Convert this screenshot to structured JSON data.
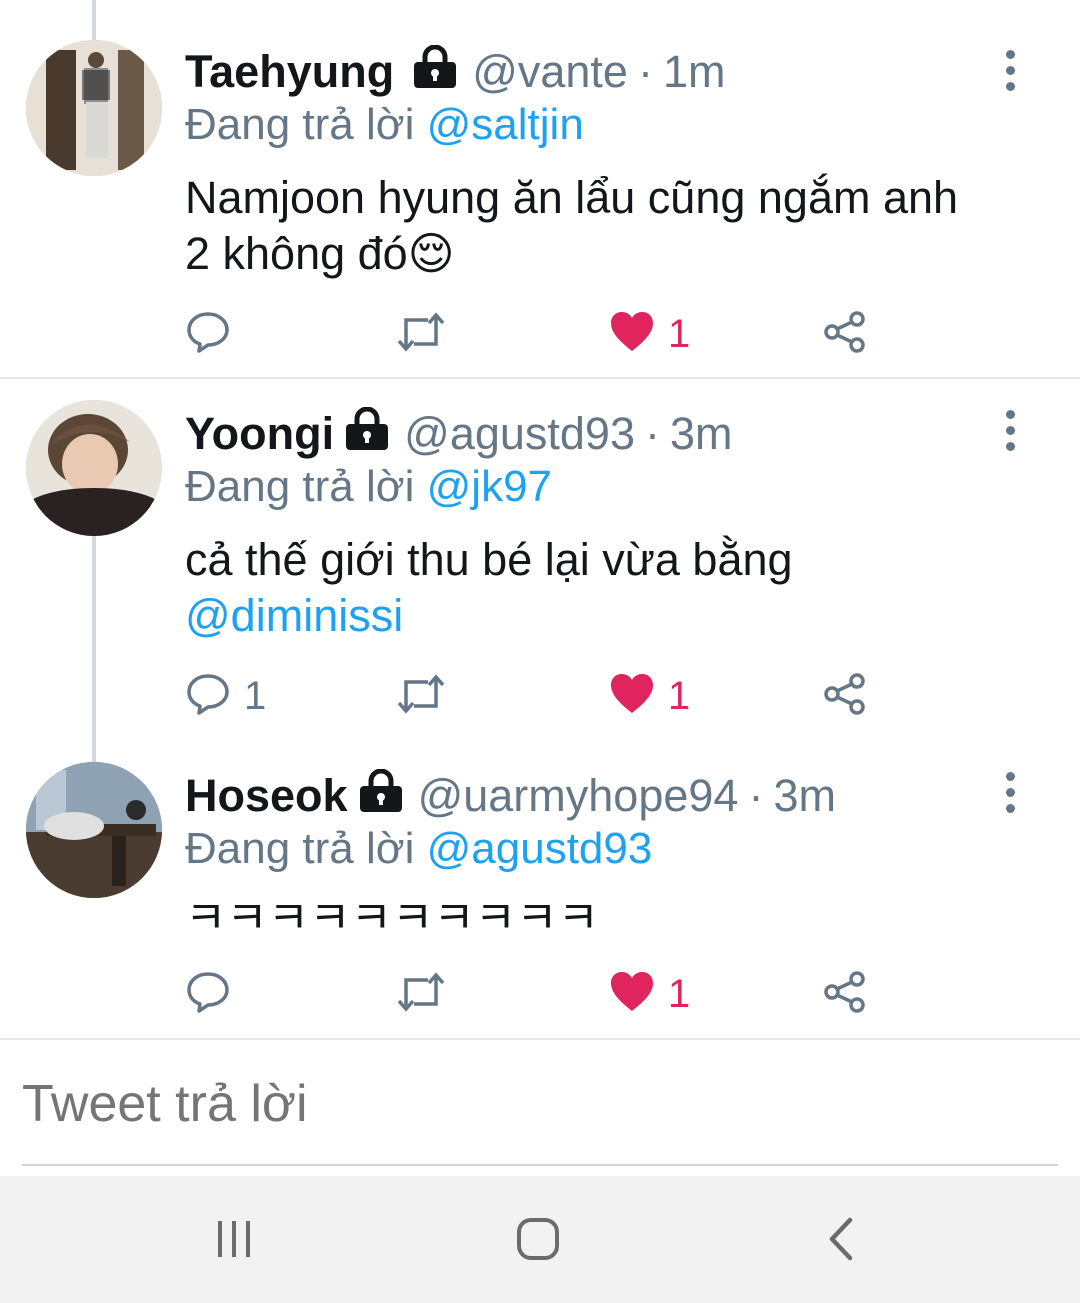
{
  "tweets": [
    {
      "name": "Taehyung",
      "handle": "@vante",
      "separator": "·",
      "time": "1m",
      "reply_prefix": "Đang trả lời",
      "reply_to": "@saltjin",
      "text_line1": "Namjoon hyung ăn lẩu cũng ngắm anh",
      "text_line2": "2 không đó😌",
      "reply_count": "",
      "retweet_count": "",
      "like_count": "1",
      "liked": true
    },
    {
      "name": "Yoongi",
      "handle": "@agustd93",
      "separator": "·",
      "time": "3m",
      "reply_prefix": "Đang trả lời",
      "reply_to": "@jk97",
      "text_line1": "cả thế giới thu bé lại vừa bằng",
      "text_line2_mention": "@diminissi",
      "reply_count": "1",
      "retweet_count": "",
      "like_count": "1",
      "liked": true
    },
    {
      "name": "Hoseok",
      "handle": "@uarmyhope94",
      "separator": "·",
      "time": "3m",
      "reply_prefix": "Đang trả lời",
      "reply_to": "@agustd93",
      "text_line1": "ㅋㅋㅋㅋㅋㅋㅋㅋㅋㅋ",
      "reply_count": "",
      "retweet_count": "",
      "like_count": "1",
      "liked": true
    }
  ],
  "compose": {
    "placeholder": "Tweet trả lời"
  },
  "colors": {
    "accent": "#1da1f2",
    "like": "#e0245e",
    "muted": "#657786",
    "text": "#14171a"
  },
  "icons": [
    "lock-icon",
    "more-vertical-icon",
    "reply-icon",
    "retweet-icon",
    "heart-icon",
    "share-icon",
    "recent-apps-icon",
    "home-icon",
    "back-icon"
  ]
}
